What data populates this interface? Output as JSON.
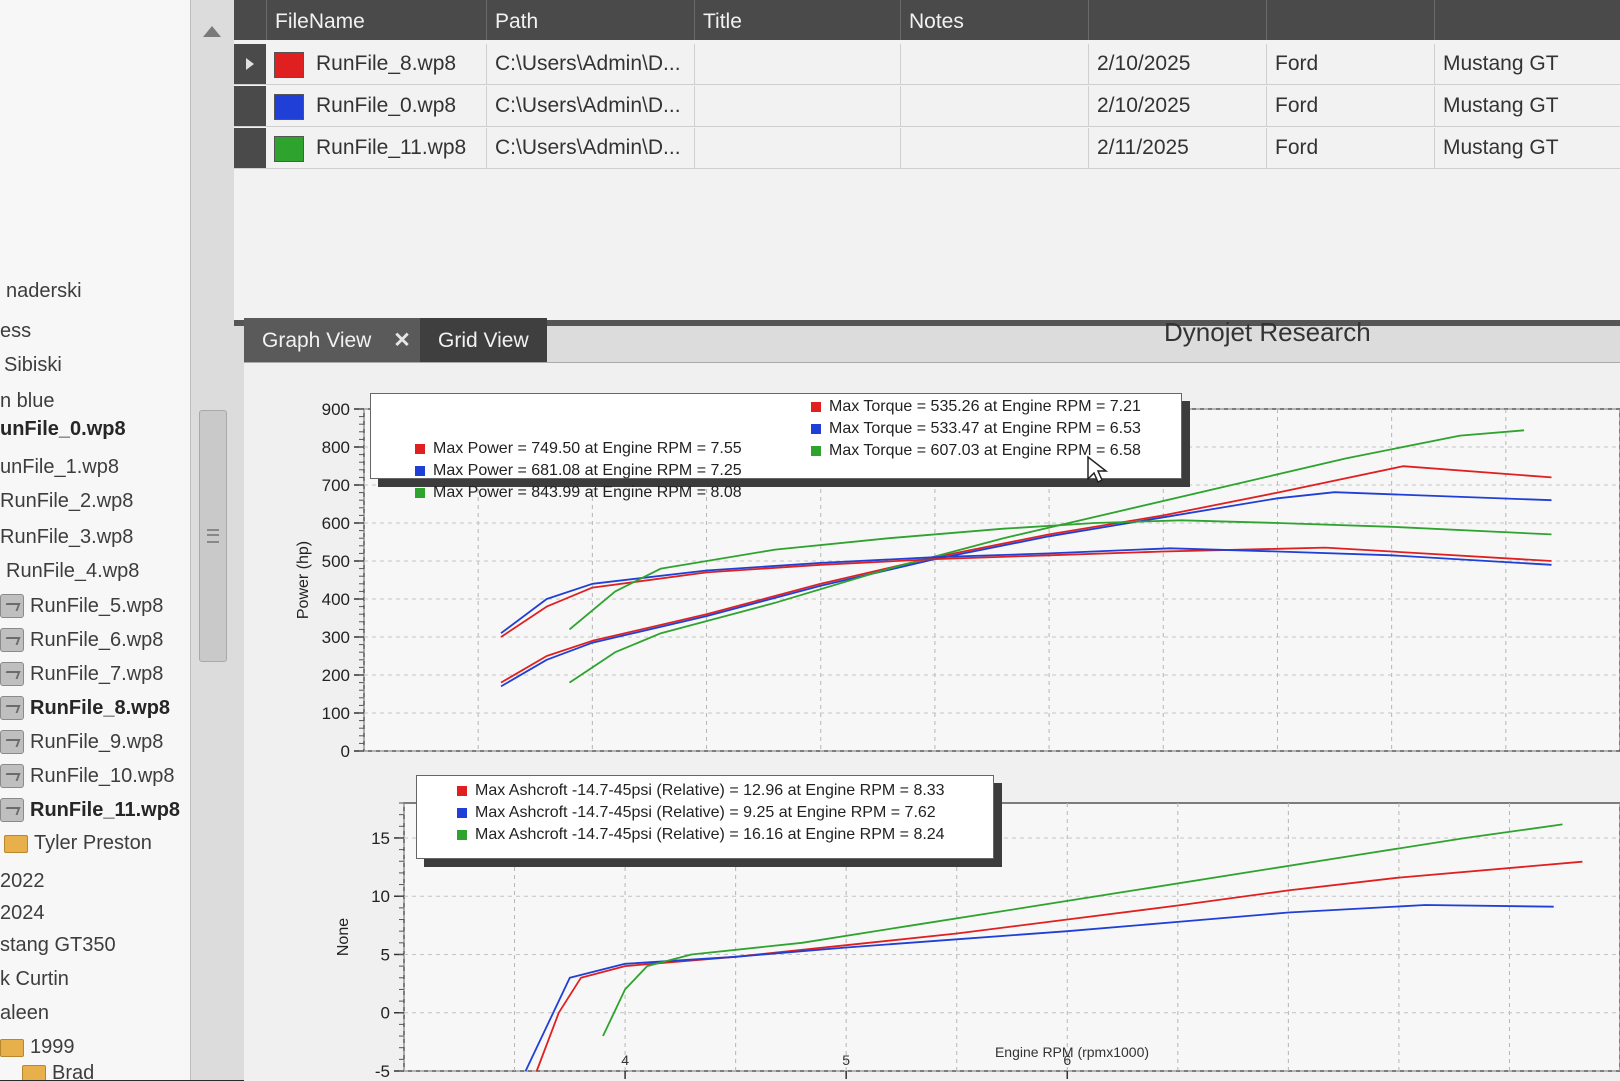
{
  "tree": {
    "items": [
      {
        "label": "naderski",
        "bold": false,
        "icon": ""
      },
      {
        "label": "ess",
        "bold": false,
        "icon": ""
      },
      {
        "label": "Sibiski",
        "bold": false,
        "icon": ""
      },
      {
        "label": "n blue",
        "bold": false,
        "icon": ""
      },
      {
        "label": "unFile_0.wp8",
        "bold": true,
        "icon": ""
      },
      {
        "label": "unFile_1.wp8",
        "bold": false,
        "icon": ""
      },
      {
        "label": "RunFile_2.wp8",
        "bold": false,
        "icon": ""
      },
      {
        "label": "RunFile_3.wp8",
        "bold": false,
        "icon": ""
      },
      {
        "label": "RunFile_4.wp8",
        "bold": false,
        "icon": ""
      },
      {
        "label": "RunFile_5.wp8",
        "bold": false,
        "icon": "file-icon"
      },
      {
        "label": "RunFile_6.wp8",
        "bold": false,
        "icon": "file-icon"
      },
      {
        "label": "RunFile_7.wp8",
        "bold": false,
        "icon": "file-icon"
      },
      {
        "label": "RunFile_8.wp8",
        "bold": true,
        "icon": "file-icon"
      },
      {
        "label": "RunFile_9.wp8",
        "bold": false,
        "icon": "file-icon"
      },
      {
        "label": "RunFile_10.wp8",
        "bold": false,
        "icon": "file-icon"
      },
      {
        "label": "RunFile_11.wp8",
        "bold": true,
        "icon": "file-icon"
      },
      {
        "label": "Tyler Preston",
        "bold": false,
        "icon": "folder-icon"
      },
      {
        "label": "2022",
        "bold": false,
        "icon": ""
      },
      {
        "label": "2024",
        "bold": false,
        "icon": ""
      },
      {
        "label": "stang GT350",
        "bold": false,
        "icon": ""
      },
      {
        "label": "k Curtin",
        "bold": false,
        "icon": ""
      },
      {
        "label": "aleen",
        "bold": false,
        "icon": ""
      },
      {
        "label": "1999",
        "bold": false,
        "icon": "folder-icon"
      },
      {
        "label": "Brad",
        "bold": false,
        "icon": "folder-icon"
      }
    ]
  },
  "table": {
    "columns": [
      "FileName",
      "Path",
      "Title",
      "Notes",
      "",
      "",
      ""
    ],
    "rows": [
      {
        "color": "#e02020",
        "filename": "RunFile_8.wp8",
        "path": "C:\\Users\\Admin\\D...",
        "title": "",
        "notes": "",
        "date": "2/10/2025",
        "make": "Ford",
        "model": "Mustang GT",
        "selected": true
      },
      {
        "color": "#1f3fd6",
        "filename": "RunFile_0.wp8",
        "path": "C:\\Users\\Admin\\D...",
        "title": "",
        "notes": "",
        "date": "2/10/2025",
        "make": "Ford",
        "model": "Mustang GT",
        "selected": false
      },
      {
        "color": "#2ea32e",
        "filename": "RunFile_11.wp8",
        "path": "C:\\Users\\Admin\\D...",
        "title": "",
        "notes": "",
        "date": "2/11/2025",
        "make": "Ford",
        "model": "Mustang GT",
        "selected": false
      }
    ]
  },
  "tabs": [
    {
      "label": "Graph View",
      "close": "✕",
      "active": true
    },
    {
      "label": "Grid View",
      "active": false
    }
  ],
  "chart_title": "Dynojet Research",
  "legend_power": [
    {
      "color": "#e02020",
      "text": "Max Power = 749.50 at Engine RPM = 7.55"
    },
    {
      "color": "#1f3fd6",
      "text": "Max Power = 681.08 at Engine RPM = 7.25"
    },
    {
      "color": "#2ea32e",
      "text": "Max Power = 843.99 at Engine RPM = 8.08"
    }
  ],
  "legend_torque": [
    {
      "color": "#e02020",
      "text": "Max Torque = 535.26 at Engine RPM = 7.21"
    },
    {
      "color": "#1f3fd6",
      "text": "Max Torque = 533.47 at Engine RPM = 6.53"
    },
    {
      "color": "#2ea32e",
      "text": "Max Torque = 607.03 at Engine RPM = 6.58"
    }
  ],
  "legend_boost": [
    {
      "color": "#e02020",
      "text": "Max Ashcroft -14.7-45psi (Relative) = 12.96 at Engine RPM = 8.33"
    },
    {
      "color": "#1f3fd6",
      "text": "Max Ashcroft -14.7-45psi (Relative) = 9.25 at Engine RPM = 7.62"
    },
    {
      "color": "#2ea32e",
      "text": "Max Ashcroft -14.7-45psi (Relative) = 16.16 at Engine RPM = 8.24"
    }
  ],
  "chart_data": [
    {
      "type": "line",
      "title": "Dynojet Research",
      "ylabel": "Power (hp)",
      "xlabel": "",
      "ylim": [
        0,
        900
      ],
      "yticks": [
        0,
        100,
        200,
        300,
        400,
        500,
        600,
        700,
        800,
        900
      ],
      "xlim": [
        3,
        8.5
      ],
      "grid": true,
      "series": [
        {
          "color": "#e02020",
          "x": [
            3.6,
            3.8,
            4.0,
            4.5,
            5.0,
            5.5,
            6.0,
            6.5,
            7.0,
            7.55,
            8.2
          ],
          "y": [
            180,
            250,
            290,
            360,
            440,
            510,
            570,
            620,
            680,
            749.5,
            720
          ]
        },
        {
          "color": "#1f3fd6",
          "x": [
            3.6,
            3.8,
            4.0,
            4.5,
            5.0,
            5.5,
            6.0,
            6.5,
            7.0,
            7.25,
            8.2
          ],
          "y": [
            170,
            240,
            285,
            355,
            435,
            505,
            565,
            615,
            665,
            681.08,
            660
          ]
        },
        {
          "color": "#2ea32e",
          "x": [
            3.9,
            4.1,
            4.3,
            4.8,
            5.3,
            5.8,
            6.3,
            6.8,
            7.3,
            7.8,
            8.08
          ],
          "y": [
            180,
            260,
            310,
            390,
            480,
            560,
            630,
            700,
            770,
            830,
            843.99
          ]
        },
        {
          "color": "#e02020",
          "x": [
            3.6,
            3.8,
            4.0,
            4.5,
            5.0,
            5.5,
            6.0,
            6.5,
            7.0,
            7.21,
            8.2
          ],
          "y": [
            300,
            380,
            430,
            470,
            490,
            505,
            515,
            525,
            532,
            535.26,
            500
          ]
        },
        {
          "color": "#1f3fd6",
          "x": [
            3.6,
            3.8,
            4.0,
            4.5,
            5.0,
            5.5,
            6.0,
            6.53,
            7.0,
            7.5,
            8.2
          ],
          "y": [
            310,
            400,
            440,
            475,
            495,
            510,
            520,
            533.47,
            525,
            515,
            490
          ]
        },
        {
          "color": "#2ea32e",
          "x": [
            3.9,
            4.1,
            4.3,
            4.8,
            5.3,
            5.8,
            6.2,
            6.58,
            7.0,
            7.5,
            8.2
          ],
          "y": [
            320,
            420,
            480,
            530,
            560,
            585,
            600,
            607.03,
            600,
            590,
            570
          ]
        }
      ]
    },
    {
      "type": "line",
      "title": "",
      "ylabel": "None",
      "xlabel": "Engine RPM (rpmx1000)",
      "ylim": [
        -5,
        18
      ],
      "yticks": [
        -5,
        0,
        5,
        10,
        15
      ],
      "xlim": [
        3,
        8.5
      ],
      "xticks": [
        4,
        5,
        6
      ],
      "grid": true,
      "series": [
        {
          "color": "#e02020",
          "x": [
            3.6,
            3.7,
            3.8,
            4.0,
            4.5,
            5.0,
            5.5,
            6.0,
            6.5,
            7.0,
            7.5,
            8.33
          ],
          "y": [
            -5,
            0,
            3,
            4,
            4.8,
            5.8,
            6.8,
            8,
            9.2,
            10.5,
            11.6,
            12.96
          ]
        },
        {
          "color": "#1f3fd6",
          "x": [
            3.55,
            3.65,
            3.75,
            4.0,
            4.5,
            5.0,
            5.5,
            6.0,
            6.5,
            7.0,
            7.62,
            8.2
          ],
          "y": [
            -5,
            -1,
            3,
            4.2,
            4.8,
            5.6,
            6.3,
            7,
            7.8,
            8.6,
            9.25,
            9.1
          ]
        },
        {
          "color": "#2ea32e",
          "x": [
            3.9,
            4.0,
            4.1,
            4.3,
            4.8,
            5.3,
            5.8,
            6.3,
            6.8,
            7.3,
            7.8,
            8.24
          ],
          "y": [
            -2,
            2,
            4,
            5,
            6,
            7.5,
            9,
            10.5,
            12,
            13.5,
            15,
            16.16
          ]
        }
      ]
    }
  ]
}
